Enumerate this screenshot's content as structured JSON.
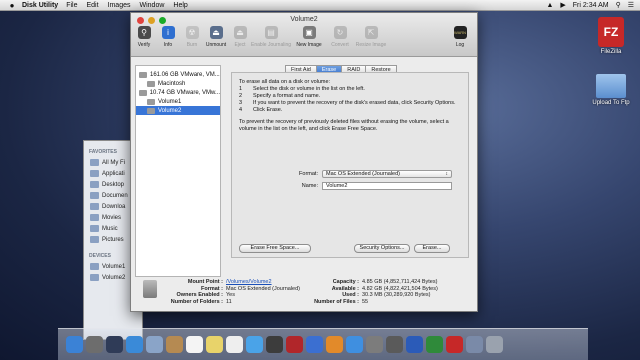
{
  "menubar": {
    "app_name": "Disk Utility",
    "items": [
      "File",
      "Edit",
      "Images",
      "Window",
      "Help"
    ],
    "clock": "Fri 2:34 AM"
  },
  "desktop_icons": [
    {
      "label": "FileZilla",
      "icon": "filezilla-icon"
    },
    {
      "label": "Upload To Ftp",
      "icon": "folder-icon"
    }
  ],
  "finder": {
    "favorites_header": "FAVORITES",
    "favorites": [
      "All My Fi",
      "Applicati",
      "Desktop",
      "Documen",
      "Downloa",
      "Movies",
      "Music",
      "Pictures"
    ],
    "devices_header": "DEVICES",
    "devices": [
      "Volume1",
      "Volume2"
    ]
  },
  "window": {
    "title": "Volume2",
    "toolbar": [
      {
        "label": "Verify",
        "icon": "microscope-icon",
        "enabled": true
      },
      {
        "label": "Info",
        "icon": "info-icon",
        "enabled": true
      },
      {
        "label": "Burn",
        "icon": "burn-icon",
        "enabled": false
      },
      {
        "label": "Unmount",
        "icon": "unmount-icon",
        "enabled": true
      },
      {
        "label": "Eject",
        "icon": "eject-icon",
        "enabled": false
      },
      {
        "label": "Enable Journaling",
        "icon": "journal-icon",
        "enabled": false
      },
      {
        "label": "New Image",
        "icon": "new-image-icon",
        "enabled": true
      },
      {
        "label": "Convert",
        "icon": "convert-icon",
        "enabled": false
      },
      {
        "label": "Resize Image",
        "icon": "resize-image-icon",
        "enabled": false
      }
    ],
    "log_label": "Log",
    "sidebar": [
      {
        "label": "161.06 GB VMware, VM...",
        "indent": 0,
        "selected": false
      },
      {
        "label": "Macintosh",
        "indent": 1,
        "selected": false
      },
      {
        "label": "10.74 GB VMware, VMw...",
        "indent": 0,
        "selected": false
      },
      {
        "label": "Volume1",
        "indent": 1,
        "selected": false
      },
      {
        "label": "Volume2",
        "indent": 1,
        "selected": true
      }
    ],
    "tabs": [
      {
        "label": "First Aid",
        "selected": false
      },
      {
        "label": "Erase",
        "selected": true
      },
      {
        "label": "RAID",
        "selected": false
      },
      {
        "label": "Restore",
        "selected": false
      }
    ],
    "erase": {
      "intro": "To erase all data on a disk or volume:",
      "steps": [
        {
          "n": "1",
          "text": "Select the disk or volume in the list on the left."
        },
        {
          "n": "2",
          "text": "Specify a format and name."
        },
        {
          "n": "3",
          "text": "If you want to prevent the recovery of the disk's erased data, click Security Options."
        },
        {
          "n": "4",
          "text": "Click Erase."
        }
      ],
      "prevent_text": "To prevent the recovery of previously deleted files without erasing the volume, select a volume in the list on the left, and click Erase Free Space.",
      "format_label": "Format:",
      "format_value": "Mac OS Extended (Journaled)",
      "name_label": "Name:",
      "name_value": "Volume2",
      "erase_free_space_button": "Erase Free Space...",
      "security_options_button": "Security Options...",
      "erase_button": "Erase..."
    },
    "info": {
      "left": [
        {
          "key": "Mount Point :",
          "value": "/Volumes/Volume2",
          "link": true
        },
        {
          "key": "Format :",
          "value": "Mac OS Extended (Journaled)",
          "link": false
        },
        {
          "key": "Owners Enabled :",
          "value": "Yes",
          "link": false
        },
        {
          "key": "Number of Folders :",
          "value": "11",
          "link": false
        }
      ],
      "right": [
        {
          "key": "Capacity :",
          "value": "4.85 GB (4,852,711,424 Bytes)"
        },
        {
          "key": "Available :",
          "value": "4.82 GB (4,822,421,504 Bytes)"
        },
        {
          "key": "Used :",
          "value": "30.3 MB (30,289,920 Bytes)"
        },
        {
          "key": "Number of Files :",
          "value": "55"
        }
      ]
    }
  },
  "dock": [
    {
      "icon": "finder-icon",
      "color": "#3b82d6"
    },
    {
      "icon": "launchpad-icon",
      "color": "#6d6d6d"
    },
    {
      "icon": "mission-control-icon",
      "color": "#2f3b57"
    },
    {
      "icon": "safari-icon",
      "color": "#3a8ad8"
    },
    {
      "icon": "mail-icon",
      "color": "#8aa4c8"
    },
    {
      "icon": "contacts-icon",
      "color": "#b58a52"
    },
    {
      "icon": "calendar-icon",
      "color": "#f4f4f4"
    },
    {
      "icon": "notes-icon",
      "color": "#e8d36a"
    },
    {
      "icon": "reminders-icon",
      "color": "#eeeeee"
    },
    {
      "icon": "messages-icon",
      "color": "#4aa3e8"
    },
    {
      "icon": "facetime-icon",
      "color": "#3c3c3c"
    },
    {
      "icon": "photo-booth-icon",
      "color": "#b1262a"
    },
    {
      "icon": "itunes-icon",
      "color": "#3b6fd1"
    },
    {
      "icon": "ibooks-icon",
      "color": "#e28a2a"
    },
    {
      "icon": "app-store-icon",
      "color": "#3f8fe0"
    },
    {
      "icon": "system-preferences-icon",
      "color": "#7c7c7c"
    },
    {
      "icon": "vmware-icon",
      "color": "#5a5a5a"
    },
    {
      "icon": "word-icon",
      "color": "#2b5bb8"
    },
    {
      "icon": "excel-icon",
      "color": "#2f8a3a"
    },
    {
      "icon": "filezilla-icon",
      "color": "#c62828"
    },
    {
      "icon": "downloads-icon",
      "color": "#7a8aa8"
    },
    {
      "icon": "trash-icon",
      "color": "#9aa2ae"
    }
  ]
}
